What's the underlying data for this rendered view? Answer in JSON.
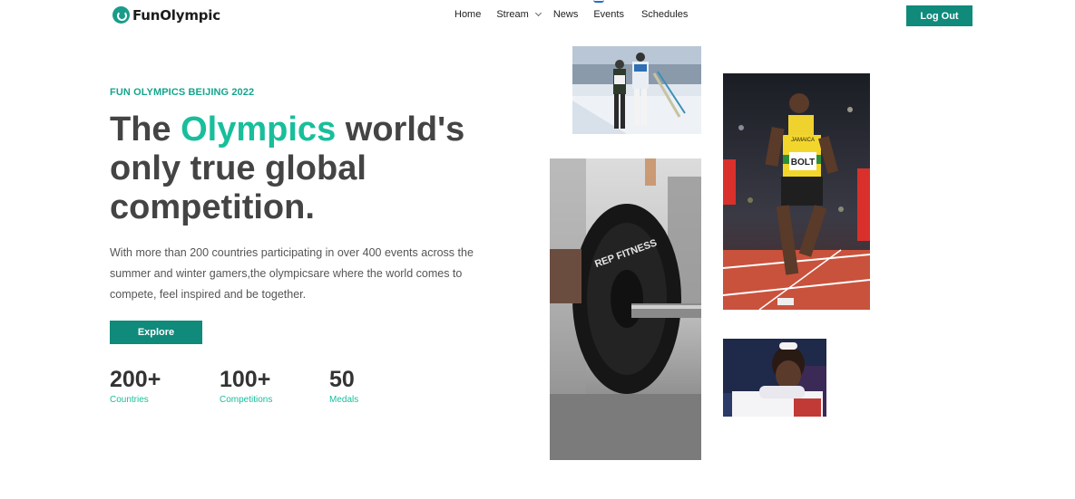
{
  "brand": {
    "name": "FunOlympic",
    "color": "#0f8a7b",
    "accent": "#19be9b"
  },
  "nav": [
    {
      "label": "Home"
    },
    {
      "label": "Stream",
      "has_dropdown": true
    },
    {
      "label": "News"
    },
    {
      "label": "Events"
    },
    {
      "label": "Schedules"
    }
  ],
  "header": {
    "logout_label": "Log Out"
  },
  "hero": {
    "eyebrow": "FUN OLYMPICS BEIJING 2022",
    "headline_pre": "The ",
    "headline_accent": "Olympics",
    "headline_post": " world's only true global competition.",
    "description": "With more than 200 countries participating in over 400 events across the summer and winter gamers,the olympicsare where the world comes to compete, feel inspired and be together.",
    "explore_label": "Explore"
  },
  "stats": [
    {
      "value": "200+",
      "label": "Countries"
    },
    {
      "value": "100+",
      "label": "Competitions"
    },
    {
      "value": "50",
      "label": "Medals"
    }
  ],
  "photos": {
    "skiing": {
      "alt": "Cross-country skiers"
    },
    "sprinter": {
      "bib": "BOLT",
      "team": "JAMAICA"
    },
    "barbell": {
      "plate_text": "REP FITNESS"
    },
    "gymnast": {
      "alt": "Gymnast"
    }
  }
}
